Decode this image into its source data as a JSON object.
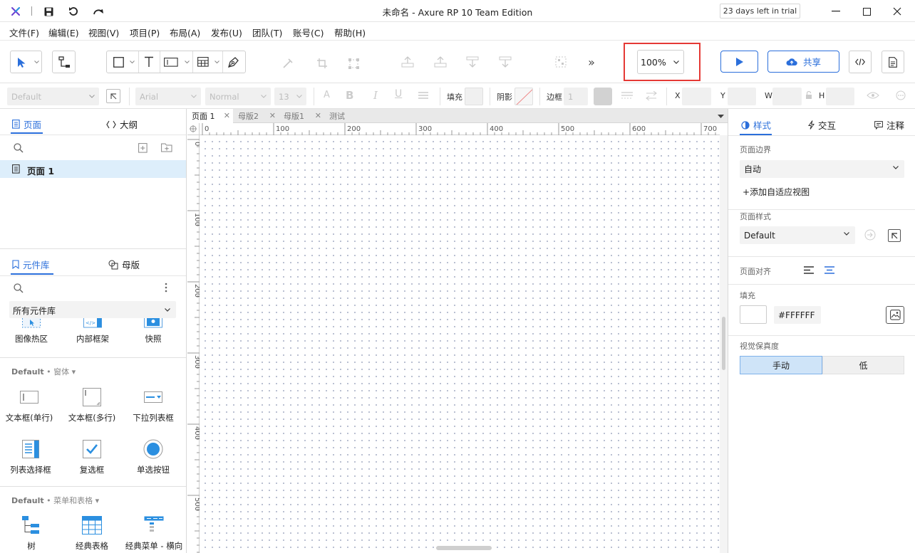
{
  "window": {
    "title": "未命名 - Axure RP 10 Team Edition",
    "trial": "23 days left in trial"
  },
  "menu": [
    "文件(F)",
    "编辑(E)",
    "视图(V)",
    "项目(P)",
    "布局(A)",
    "发布(U)",
    "团队(T)",
    "账号(C)",
    "帮助(H)"
  ],
  "toolbar": {
    "zoom": "100%",
    "share_label": "共享",
    "more": "»"
  },
  "format_bar": {
    "style": "Default",
    "font": "Arial",
    "weight": "Normal",
    "size": "13",
    "fill_label": "填充",
    "shadow_label": "阴影",
    "border_label": "边框",
    "border_value": "1",
    "x_label": "X",
    "y_label": "Y",
    "w_label": "W",
    "h_label": "H"
  },
  "left_panel": {
    "pages_tab": "页面",
    "outline_tab": "大纲",
    "page_items": [
      "页面 1"
    ],
    "library_tab": "元件库",
    "masters_tab": "母版",
    "library_select": "所有元件库",
    "top_items": [
      "图像热区",
      "内部框架",
      "快照"
    ],
    "section1_lib": "Default",
    "section1_name": "窗体",
    "section1_items": [
      "文本框(单行)",
      "文本框(多行)",
      "下拉列表框",
      "列表选择框",
      "复选框",
      "单选按钮"
    ],
    "section2_lib": "Default",
    "section2_name": "菜单和表格",
    "section2_items": [
      "树",
      "经典表格",
      "经典菜单 - 横向"
    ]
  },
  "canvas": {
    "tabs": [
      "页面 1",
      "母版2",
      "母版1",
      "测试"
    ],
    "h_ticks": [
      "0",
      "100",
      "200",
      "300",
      "400",
      "500",
      "600",
      "700"
    ],
    "v_ticks": [
      "0",
      "100",
      "200",
      "300",
      "400",
      "500"
    ]
  },
  "right_panel": {
    "tabs": [
      "样式",
      "交互",
      "注释"
    ],
    "page_bounds_label": "页面边界",
    "page_bounds_value": "自动",
    "add_adaptive": "添加自适应视图",
    "page_style_label": "页面样式",
    "page_style_value": "Default",
    "page_align_label": "页面对齐",
    "fill_label": "填充",
    "fill_hex": "#FFFFFF",
    "fidelity_label": "视觉保真度",
    "fidelity_options": [
      "手动",
      "低"
    ]
  },
  "colors": {
    "accent": "#2b6fdb",
    "highlight": "#e53935",
    "selected_row": "#ddeefb"
  }
}
